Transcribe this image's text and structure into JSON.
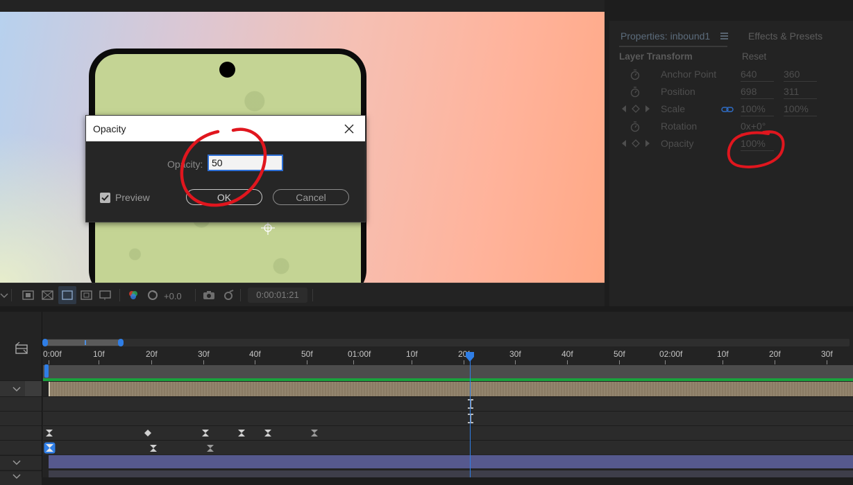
{
  "viewer": {
    "toolbar": {
      "exposure": "+0.0",
      "timecode": "0:00:01:21"
    }
  },
  "properties_panel": {
    "tab_properties": "Properties: inbound1",
    "tab_effects": "Effects & Presets",
    "section": "Layer Transform",
    "reset": "Reset",
    "rows": [
      {
        "label": "Anchor Point",
        "v1": "640",
        "v2": "360"
      },
      {
        "label": "Position",
        "v1": "698",
        "v2": "311"
      },
      {
        "label": "Scale",
        "v1": "100%",
        "v2": "100%"
      },
      {
        "label": "Rotation",
        "v1": "0x+0°",
        "v2": ""
      },
      {
        "label": "Opacity",
        "v1": "100%",
        "v2": ""
      }
    ]
  },
  "dialog": {
    "title": "Opacity",
    "field_label": "Opacity:",
    "field_value": "50",
    "preview_label": "Preview",
    "preview_checked": true,
    "ok_label": "OK",
    "cancel_label": "Cancel"
  },
  "timeline": {
    "ruler_labels": [
      "0:00f",
      "10f",
      "20f",
      "30f",
      "40f",
      "50f",
      "01:00f",
      "10f",
      "20f",
      "30f",
      "40f",
      "50f",
      "02:00f",
      "10f",
      "20f",
      "30f"
    ],
    "playhead_label": "20f"
  },
  "colors": {
    "accent_blue": "#2f7ee6",
    "annotation_red": "#e0161e",
    "layer_bar": "#8f8068",
    "work_area_green": "#19a33d",
    "purple_layer": "#56598e"
  }
}
